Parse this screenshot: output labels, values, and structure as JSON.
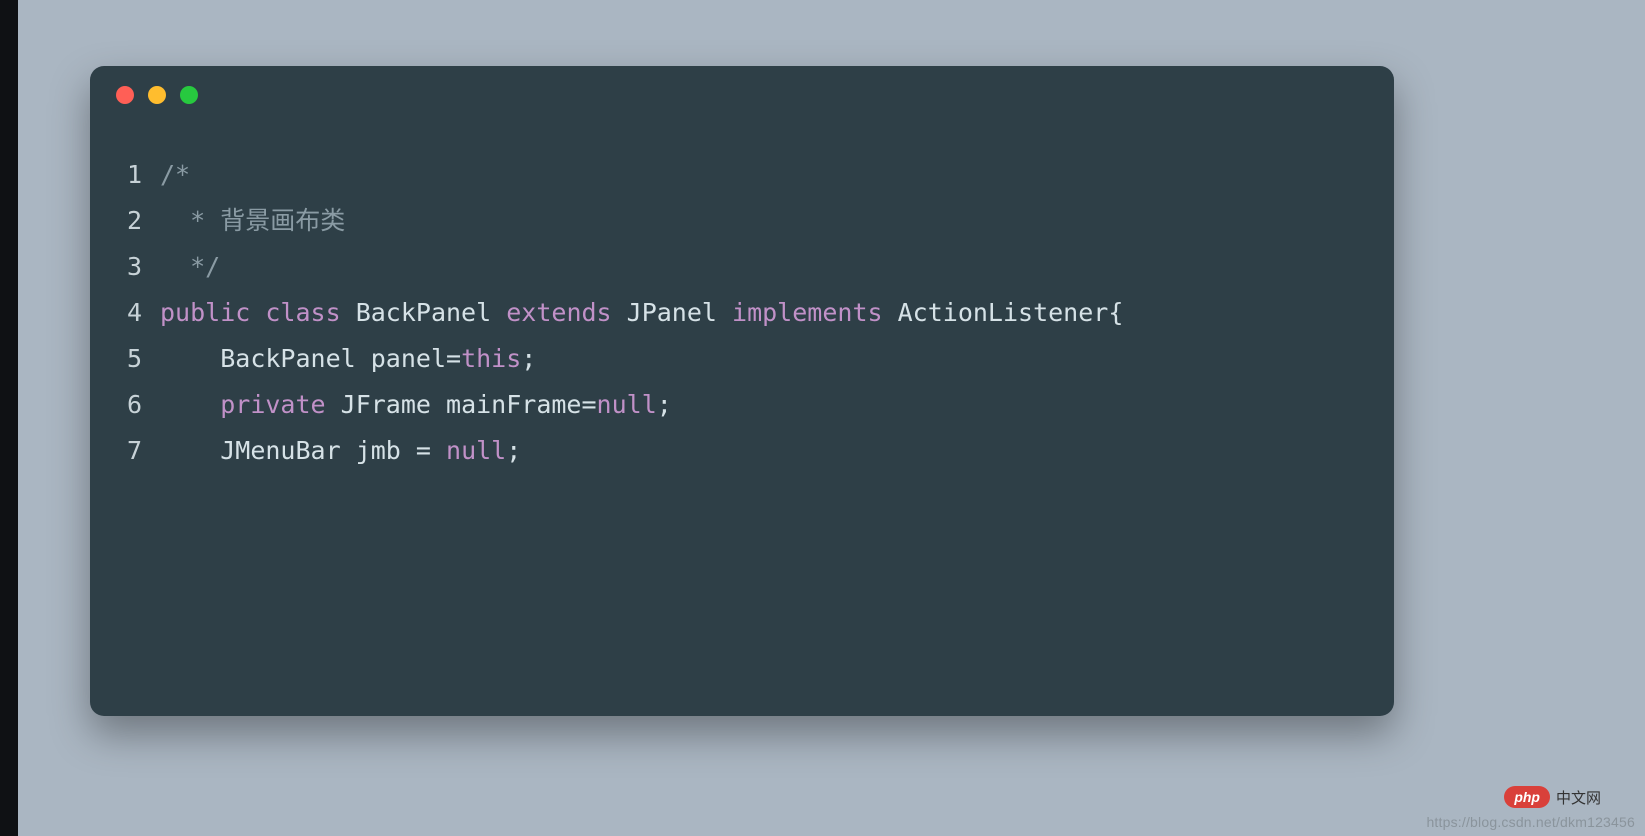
{
  "code": {
    "lines": [
      {
        "num": "1",
        "tokens": [
          {
            "cls": "tok-comment",
            "text": "/*"
          }
        ]
      },
      {
        "num": "2",
        "tokens": [
          {
            "cls": "tok-comment",
            "text": "  * 背景画布类"
          }
        ]
      },
      {
        "num": "3",
        "tokens": [
          {
            "cls": "tok-comment",
            "text": "  */"
          }
        ]
      },
      {
        "num": "4",
        "tokens": [
          {
            "cls": "tok-keyword",
            "text": "public"
          },
          {
            "cls": "tok-punct",
            "text": " "
          },
          {
            "cls": "tok-keyword",
            "text": "class"
          },
          {
            "cls": "tok-punct",
            "text": " "
          },
          {
            "cls": "tok-type",
            "text": "BackPanel"
          },
          {
            "cls": "tok-punct",
            "text": " "
          },
          {
            "cls": "tok-keyword",
            "text": "extends"
          },
          {
            "cls": "tok-punct",
            "text": " "
          },
          {
            "cls": "tok-type",
            "text": "JPanel"
          },
          {
            "cls": "tok-punct",
            "text": " "
          },
          {
            "cls": "tok-keyword",
            "text": "implements"
          },
          {
            "cls": "tok-punct",
            "text": " "
          },
          {
            "cls": "tok-type",
            "text": "ActionListener"
          },
          {
            "cls": "tok-punct",
            "text": "{"
          }
        ]
      },
      {
        "num": "5",
        "tokens": [
          {
            "cls": "tok-punct",
            "text": "    "
          },
          {
            "cls": "tok-type",
            "text": "BackPanel"
          },
          {
            "cls": "tok-punct",
            "text": " "
          },
          {
            "cls": "tok-ident",
            "text": "panel"
          },
          {
            "cls": "tok-punct",
            "text": "="
          },
          {
            "cls": "tok-this",
            "text": "this"
          },
          {
            "cls": "tok-punct",
            "text": ";"
          }
        ]
      },
      {
        "num": "6",
        "tokens": [
          {
            "cls": "tok-punct",
            "text": "    "
          },
          {
            "cls": "tok-keyword",
            "text": "private"
          },
          {
            "cls": "tok-punct",
            "text": " "
          },
          {
            "cls": "tok-type",
            "text": "JFrame"
          },
          {
            "cls": "tok-punct",
            "text": " "
          },
          {
            "cls": "tok-ident",
            "text": "mainFrame"
          },
          {
            "cls": "tok-punct",
            "text": "="
          },
          {
            "cls": "tok-literal",
            "text": "null"
          },
          {
            "cls": "tok-punct",
            "text": ";"
          }
        ]
      },
      {
        "num": "7",
        "tokens": [
          {
            "cls": "tok-punct",
            "text": "    "
          },
          {
            "cls": "tok-type",
            "text": "JMenuBar"
          },
          {
            "cls": "tok-punct",
            "text": " "
          },
          {
            "cls": "tok-ident",
            "text": "jmb"
          },
          {
            "cls": "tok-punct",
            "text": " = "
          },
          {
            "cls": "tok-literal",
            "text": "null"
          },
          {
            "cls": "tok-punct",
            "text": ";"
          }
        ]
      }
    ]
  },
  "watermark": {
    "badge_text": "php",
    "badge_label": "中文网",
    "url": "https://blog.csdn.net/dkm123456"
  }
}
